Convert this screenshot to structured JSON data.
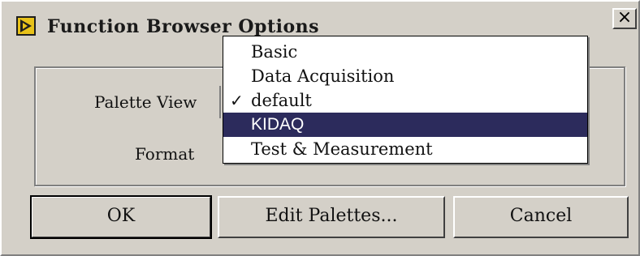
{
  "window": {
    "title": "Function Browser Options",
    "close_glyph": "×",
    "icon": "labview-icon"
  },
  "form": {
    "palette_view_label": "Palette View",
    "format_label": "Format"
  },
  "dropdown": {
    "selected_checkmark": "✓",
    "options": [
      {
        "label": "Basic"
      },
      {
        "label": "Data Acquisition"
      },
      {
        "label": "default",
        "checked": true
      },
      {
        "label": "KIDAQ",
        "highlighted": true
      },
      {
        "label": "Test & Measurement"
      }
    ]
  },
  "buttons": {
    "ok": "OK",
    "edit_palettes": "Edit Palettes...",
    "cancel": "Cancel"
  },
  "colors": {
    "dialog_bg": "#d4d0c8",
    "highlight_bg": "#2c2b5c",
    "highlight_text": "#ffffff"
  }
}
